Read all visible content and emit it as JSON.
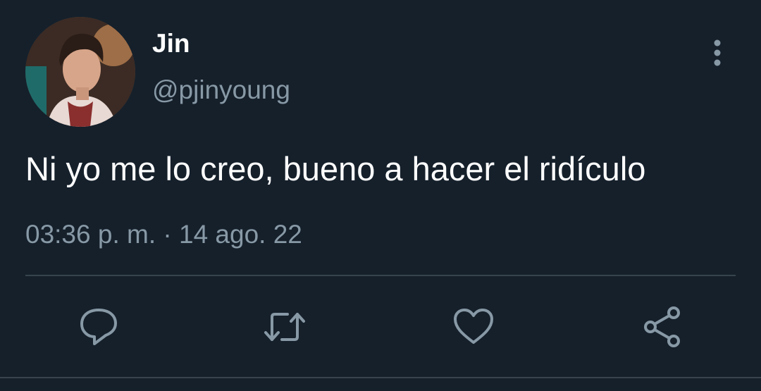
{
  "tweet": {
    "display_name": "Jin",
    "handle": "@pjinyoung",
    "text": "Ni yo me lo creo, bueno a hacer el ridículo",
    "time": "03:36 p. m.",
    "separator": "·",
    "date": "14 ago. 22"
  },
  "actions": [
    {
      "name": "reply",
      "icon": "reply-icon"
    },
    {
      "name": "retweet",
      "icon": "retweet-icon"
    },
    {
      "name": "like",
      "icon": "heart-icon"
    },
    {
      "name": "share",
      "icon": "share-icon"
    }
  ],
  "colors": {
    "background": "#15202b",
    "secondary_text": "#8899a6",
    "divider": "#38444d"
  }
}
